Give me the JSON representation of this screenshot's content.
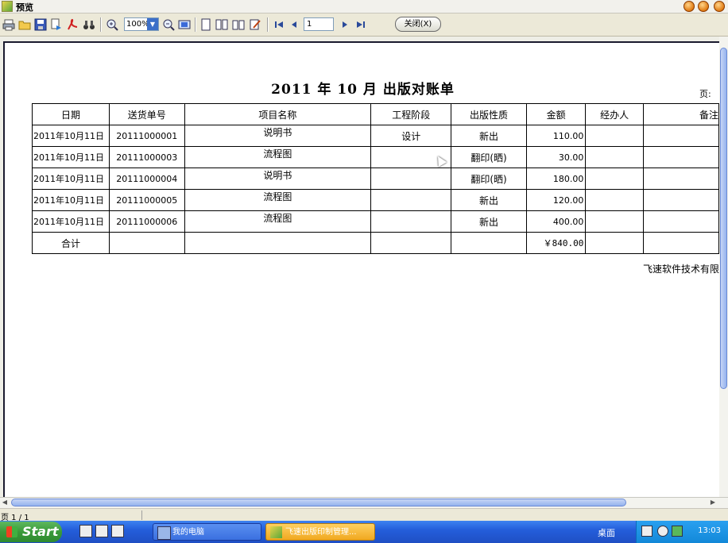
{
  "window": {
    "title": "预览"
  },
  "toolbar": {
    "zoom_value": "100%",
    "page_value": "1",
    "close_label": "关闭(X)"
  },
  "report": {
    "title": "2011 年 10 月 出版对账单",
    "page_label": "页:",
    "columns": [
      "日期",
      "送货单号",
      "项目名称",
      "工程阶段",
      "出版性质",
      "金额",
      "经办人",
      "备注"
    ],
    "rows": [
      {
        "date": "2011年10月11日",
        "no": "20111000001",
        "name": "说明书",
        "stage": "设计",
        "type": "新出",
        "amount": "110.00",
        "handler": "",
        "note": ""
      },
      {
        "date": "2011年10月11日",
        "no": "20111000003",
        "name": "流程图",
        "stage": "",
        "type": "翻印(晒)",
        "amount": "30.00",
        "handler": "",
        "note": ""
      },
      {
        "date": "2011年10月11日",
        "no": "20111000004",
        "name": "说明书",
        "stage": "",
        "type": "翻印(晒)",
        "amount": "180.00",
        "handler": "",
        "note": ""
      },
      {
        "date": "2011年10月11日",
        "no": "20111000005",
        "name": "流程图",
        "stage": "",
        "type": "新出",
        "amount": "120.00",
        "handler": "",
        "note": ""
      },
      {
        "date": "2011年10月11日",
        "no": "20111000006",
        "name": "流程图",
        "stage": "",
        "type": "新出",
        "amount": "400.00",
        "handler": "",
        "note": ""
      }
    ],
    "total_label": "合计",
    "total_amount": "￥840.00",
    "company": "飞速软件技术有限"
  },
  "statusbar": {
    "page": "页 1 / 1"
  },
  "taskbar": {
    "start_label": "Start",
    "tasks": [
      {
        "label": "我的电脑",
        "active": false
      },
      {
        "label": "飞速出版印制管理...",
        "active": true
      }
    ],
    "desktop_label": "桌面",
    "clock": "13:03"
  },
  "colors": {
    "taskbar": "#245edb",
    "start_green": "#3a9a3a",
    "active_task": "#f0b030",
    "paper_border": "#1a1a2e"
  }
}
